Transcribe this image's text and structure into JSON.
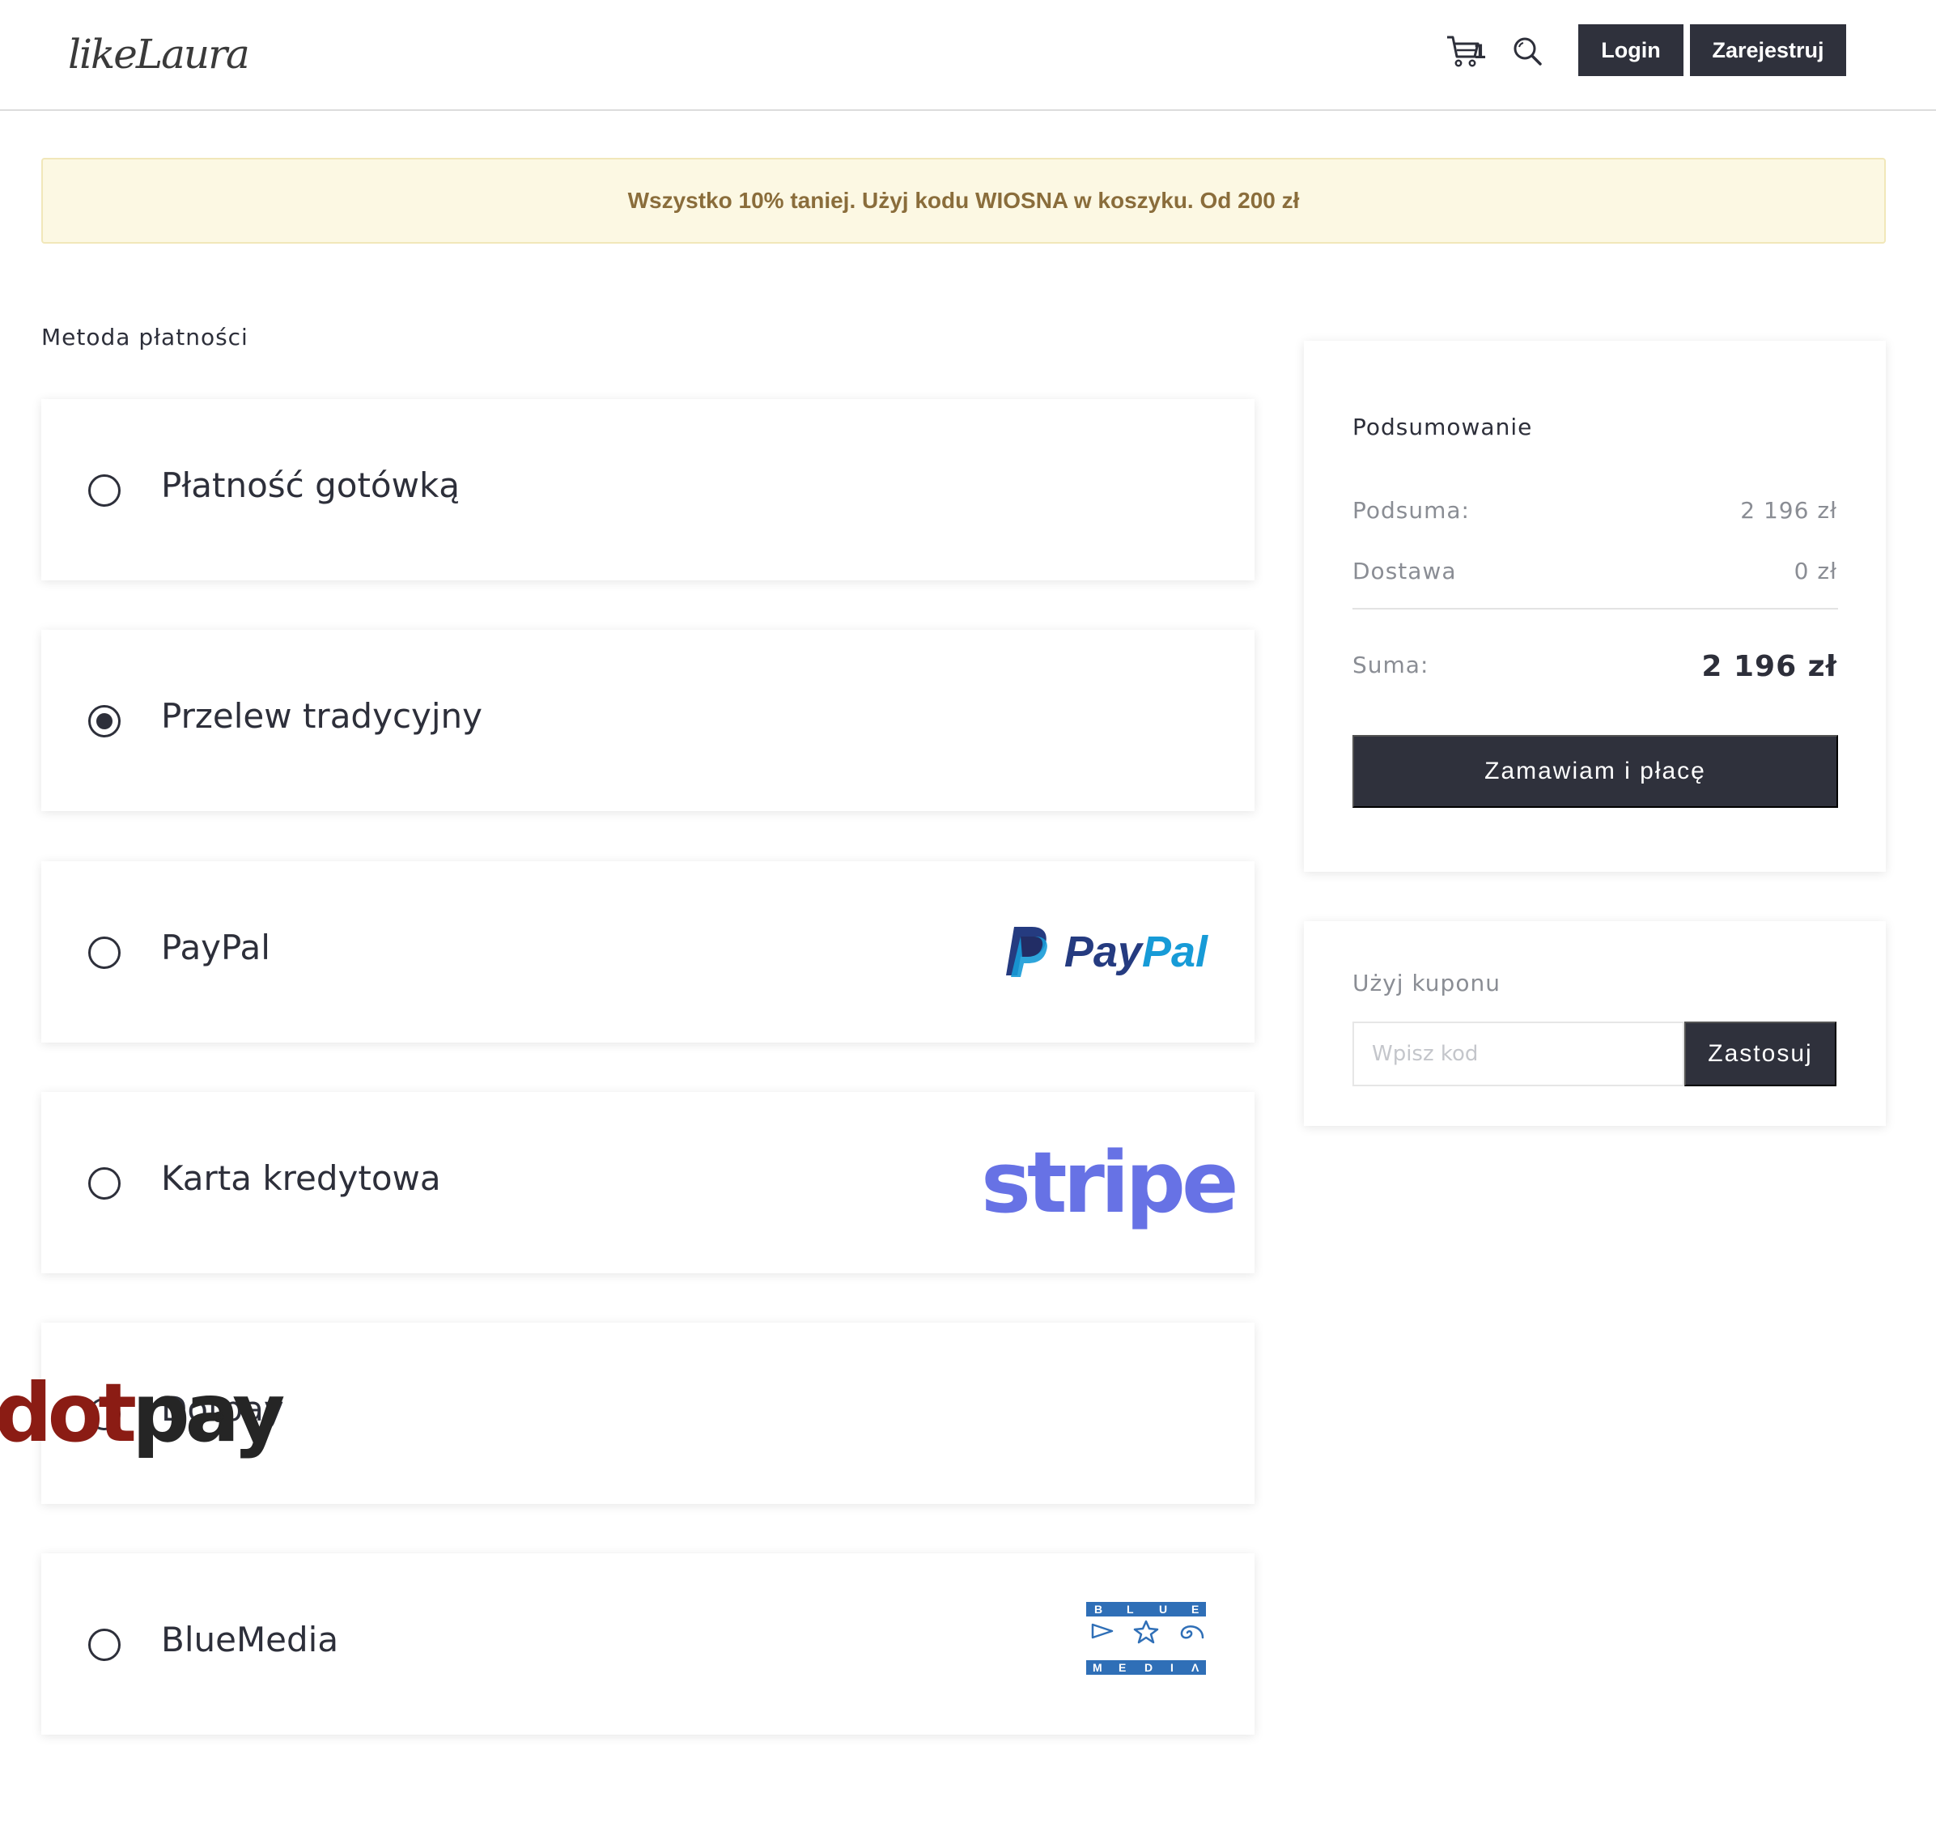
{
  "header": {
    "logo_text": "likeLaura",
    "cart_count": "1",
    "login_label": "Login",
    "register_label": "Zarejestruj"
  },
  "promo": {
    "text": "Wszystko 10% taniej. Użyj kodu WIOSNA w koszyku. Od 200 zł"
  },
  "payment": {
    "section_label": "Metoda płatności",
    "options": [
      {
        "label": "Płatność gotówką",
        "selected": false,
        "logo": null
      },
      {
        "label": "Przelew tradycyjny",
        "selected": true,
        "logo": null
      },
      {
        "label": "PayPal",
        "selected": false,
        "logo": "paypal-logo",
        "logo_text_a": "Pay",
        "logo_text_b": "Pal"
      },
      {
        "label": "Karta kredytowa",
        "selected": false,
        "logo": "stripe-logo",
        "logo_text": "stripe"
      },
      {
        "label": "Dotpay",
        "selected": false,
        "logo": "dotpay-logo",
        "logo_text_a": "dot",
        "logo_text_b": "pay",
        "logo_mark": "®"
      },
      {
        "label": "BlueMedia",
        "selected": false,
        "logo": "bluemedia-logo",
        "logo_top": "BLUE",
        "logo_bottom": "MEDIA"
      }
    ]
  },
  "summary": {
    "title": "Podsumowanie",
    "subtotal_label": "Podsuma:",
    "subtotal_value": "2 196 zł",
    "shipping_label": "Dostawa",
    "shipping_value": "0 zł",
    "total_label": "Suma:",
    "total_value": "2 196 zł",
    "order_button": "Zamawiam i płacę"
  },
  "coupon": {
    "title": "Użyj kuponu",
    "placeholder": "Wpisz kod",
    "value": "",
    "apply_button": "Zastosuj"
  },
  "colors": {
    "dark": "#2f313c",
    "promo_bg": "#fcf8e3",
    "promo_text": "#8a6d3b",
    "paypal_dark": "#253b80",
    "paypal_light": "#179bd7",
    "stripe": "#6772e5",
    "dotpay_red": "#8b1c14",
    "bluemedia": "#2f6fb7"
  }
}
